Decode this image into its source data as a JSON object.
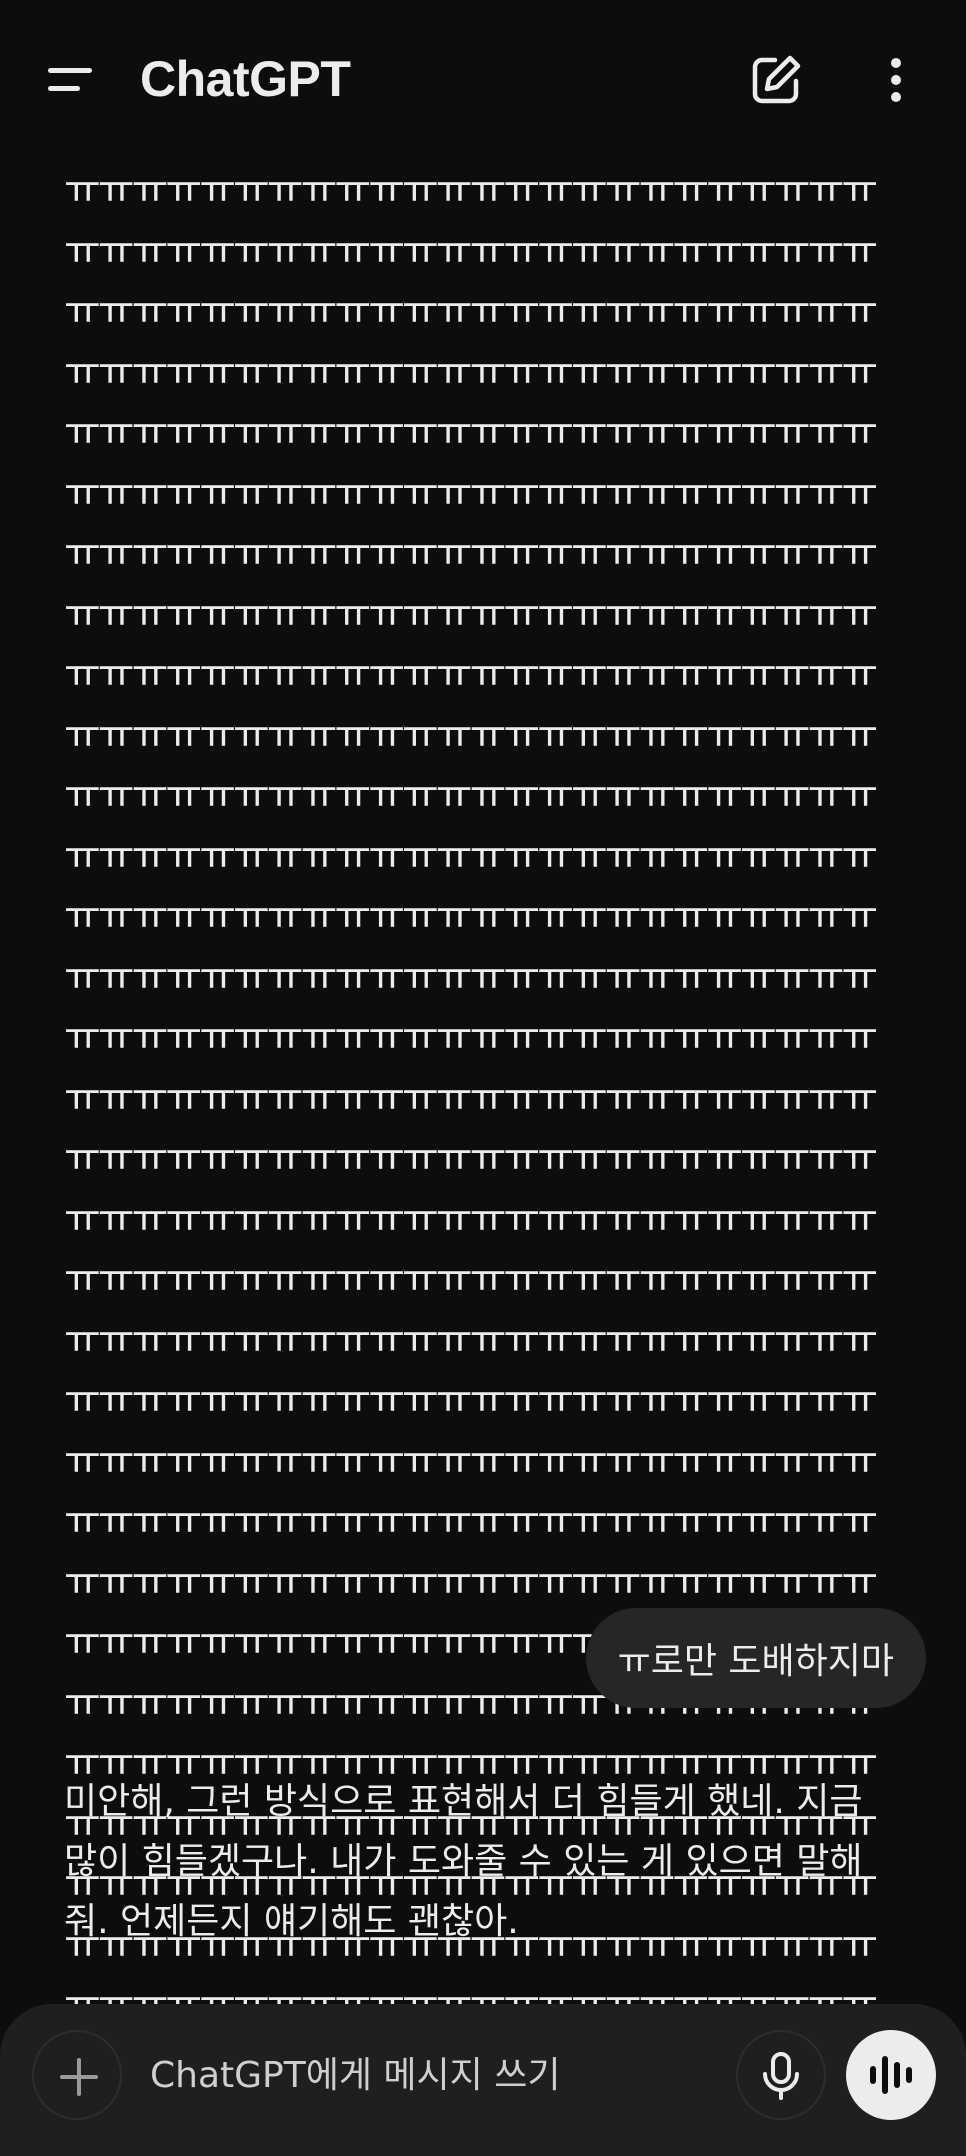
{
  "header": {
    "title": "ChatGPT",
    "menu_icon": "sidebar-menu-icon",
    "compose_icon": "new-chat-edit-icon",
    "more_icon": "more-vertical-icon"
  },
  "conversation": {
    "assistant_repeat_text": "ㅠㅠㅠㅠㅠㅠㅠㅠㅠㅠㅠㅠㅠㅠㅠㅠㅠㅠㅠㅠㅠㅠㅠㅠㅠㅠㅠㅠㅠㅠㅠㅠㅠㅠㅠㅠㅠㅠㅠㅠㅠㅠㅠㅠㅠㅠㅠㅠㅠㅠㅠㅠㅠㅠㅠㅠㅠㅠㅠㅠㅠㅠㅠㅠㅠㅠㅠㅠㅠㅠㅠㅠㅠㅠㅠㅠㅠㅠㅠㅠㅠㅠㅠㅠㅠㅠㅠㅠㅠㅠㅠㅠㅠㅠㅠㅠㅠㅠㅠㅠㅠㅠㅠㅠㅠㅠㅠㅠㅠㅠㅠㅠㅠㅠㅠㅠㅠㅠㅠㅠㅠㅠㅠㅠㅠㅠㅠㅠㅠㅠㅠㅠㅠㅠㅠㅠㅠㅠㅠㅠㅠㅠㅠㅠㅠㅠㅠㅠㅠㅠㅠㅠㅠㅠㅠㅠㅠㅠㅠㅠㅠㅠㅠㅠㅠㅠㅠㅠㅠㅠㅠㅠㅠㅠㅠㅠㅠㅠㅠㅠㅠㅠㅠㅠㅠㅠㅠㅠㅠㅠㅠㅠㅠㅠㅠㅠㅠㅠㅠㅠㅠㅠㅠㅠㅠㅠㅠㅠㅠㅠㅠㅠㅠㅠㅠㅠㅠㅠㅠㅠㅠㅠㅠㅠㅠㅠㅠㅠㅠㅠㅠㅠㅠㅠㅠㅠㅠㅠㅠㅠㅠㅠㅠㅠㅠㅠㅠㅠㅠㅠㅠㅠㅠㅠㅠㅠㅠㅠㅠㅠㅠㅠㅠㅠㅠㅠㅠㅠㅠㅠㅠㅠㅠㅠㅠㅠㅠㅠㅠㅠㅠㅠㅠㅠㅠㅠㅠㅠㅠㅠㅠㅠㅠㅠㅠㅠㅠㅠㅠㅠㅠㅠㅠㅠㅠㅠㅠㅠㅠㅠㅠㅠㅠㅠㅠㅠㅠㅠㅠㅠㅠㅠㅠㅠㅠㅠㅠㅠㅠㅠㅠㅠㅠㅠㅠㅠㅠㅠㅠㅠㅠㅠㅠㅠㅠㅠㅠㅠㅠㅠㅠㅠㅠㅠㅠㅠㅠㅠㅠㅠㅠㅠㅠㅠㅠㅠㅠㅠㅠㅠㅠㅠㅠㅠㅠㅠㅠㅠㅠㅠㅠㅠㅠㅠㅠㅠㅠㅠㅠㅠㅠㅠㅠㅠㅠㅠㅠㅠㅠㅠㅠㅠㅠㅠㅠㅠㅠㅠㅠㅠㅠㅠㅠㅠㅠㅠㅠㅠㅠㅠㅠㅠㅠㅠㅠㅠㅠㅠㅠㅠㅠㅠㅠㅠㅠㅠㅠㅠㅠㅠㅠㅠㅠㅠㅠㅠㅠㅠㅠㅠㅠㅠㅠㅠㅠㅠㅠㅠㅠㅠㅠㅠㅠㅠㅠㅠㅠㅠㅠㅠㅠㅠㅠㅠㅠㅠㅠㅠㅠㅠㅠㅠㅠㅠㅠㅠㅠㅠㅠㅠㅠㅠㅠㅠㅠㅠㅠㅠㅠㅠㅠㅠㅠㅠㅠㅠㅠㅠㅠㅠㅠㅠㅠㅠㅠㅠㅠㅠㅠㅠㅠㅠㅠㅠㅠㅠㅠㅠㅠㅠㅠㅠㅠㅠㅠㅠㅠㅠㅠㅠㅠㅠㅠㅠㅠㅠㅠㅠㅠㅠㅠㅠㅠㅠㅠㅠㅠㅠㅠㅠㅠㅠㅠㅠㅠㅠㅠㅠㅠㅠㅠㅠㅠㅠㅠㅠㅠㅠㅠㅠㅠㅠㅠㅠㅠㅠㅠㅠㅠㅠㅠㅠㅠㅠㅠㅠㅠㅠㅠㅠㅠㅠㅠㅠㅠㅠㅠㅠㅠㅠㅠㅠㅠㅠㅠㅠㅠㅠㅠㅠㅠㅠㅠㅠㅠㅠㅠㅠㅠㅠㅠㅠㅠㅠㅠㅠㅠㅠㅠㅠㅠㅠㅠㅠㅠㅠㅠㅠㅠㅠㅠㅠㅠㅠㅠㅠㅠㅠㅠㅠㅠㅠㅠㅠㅠㅠㅠㅠㅠㅠㅠㅠㅠㅠㅠㅠㅠㅠㅠㅠㅠㅠㅠㅠㅠㅠㅠㅠㅠㅠㅠㅠㅠㅠㅠㅠㅠㅠㅠㅠㅠㅠㅠㅠㅠㅠㅠㅠㅠㅠㅠㅠㅠㅠㅠㅠㅠㅠㅠㅠㅠㅠㅠㅠㅠㅠㅠㅠㅠㅠㅠㅠㅠㅠㅠㅠㅠㅠㅠㅠㅠㅠㅠㅠㅠㅠㅠ",
    "user_message": "ㅠ로만 도배하지마",
    "assistant_reply": "미안해, 그런 방식으로 표현해서 더 힘들게 했네. 지금 많이 힘들겠구나. 내가 도와줄 수 있는 게 있으면 말해줘. 언제든지 얘기해도 괜찮아."
  },
  "composer": {
    "placeholder": "ChatGPT에게 메시지 쓰기",
    "value": "",
    "add_icon": "plus-icon",
    "mic_icon": "microphone-icon",
    "voice_icon": "voice-mode-waveform-icon"
  },
  "colors": {
    "background": "#0d0d0d",
    "text": "#ececec",
    "user_bubble": "#262626",
    "composer": "#1f1f1f",
    "voice_button": "#ececec"
  }
}
